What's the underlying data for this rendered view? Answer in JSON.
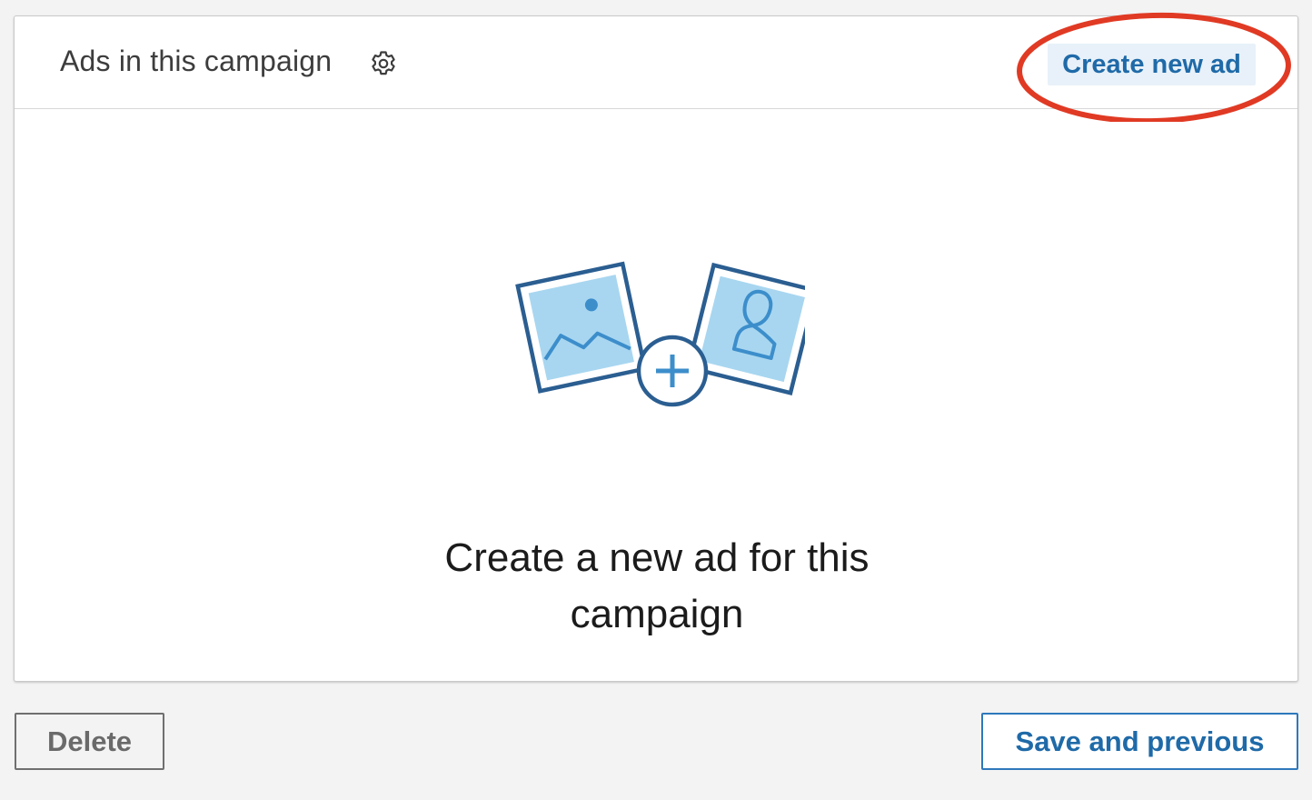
{
  "panel": {
    "title": "Ads in this campaign",
    "settings_icon": "gear-icon",
    "create_button_label": "Create new ad",
    "empty_state": {
      "illustration": "add-images-illustration",
      "message_line1": "Create a new ad for this",
      "message_line2": "campaign"
    }
  },
  "footer": {
    "delete_label": "Delete",
    "save_previous_label": "Save and previous"
  },
  "colors": {
    "accent_blue": "#1f6aa8",
    "highlight_red": "#e03a24",
    "illustration_frame": "#2b5e91",
    "illustration_fill": "#a8d6f0"
  }
}
